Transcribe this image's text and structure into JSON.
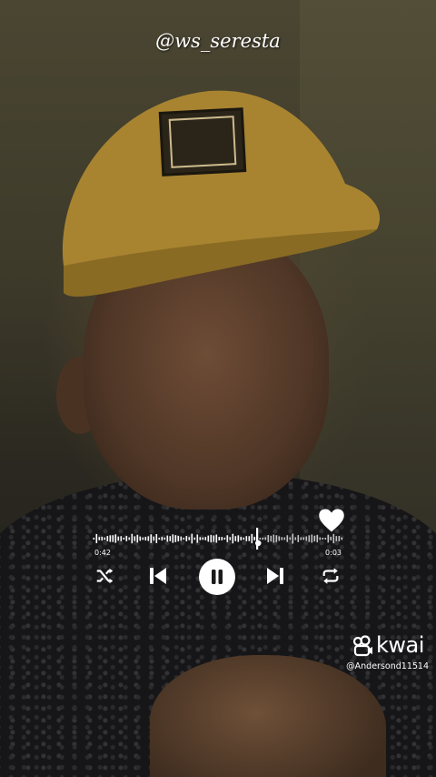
{
  "watermark": {
    "text": "@ws_seresta"
  },
  "player": {
    "elapsed": "0:42",
    "remaining": "0:03",
    "progress": 0.66,
    "liked": true,
    "state": "playing",
    "icons": {
      "heart": "heart-icon",
      "shuffle": "shuffle-icon",
      "previous": "skip-previous-icon",
      "pause": "pause-icon",
      "next": "skip-next-icon",
      "repeat": "repeat-icon"
    }
  },
  "branding": {
    "logo_icon": "kwai-logo-icon",
    "name": "kwai",
    "username": "@Andersond11514"
  },
  "colors": {
    "control": "#ffffff",
    "pause_glyph": "#1a1a1a"
  }
}
